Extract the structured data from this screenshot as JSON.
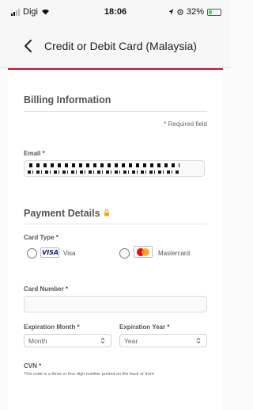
{
  "status_bar": {
    "carrier": "Digi",
    "time": "18:06",
    "battery_text": "32%",
    "battery_level": 0.32
  },
  "header": {
    "title": "Credit or Debit Card (Malaysia)"
  },
  "billing": {
    "title": "Billing Information",
    "required_note": "* Required field",
    "email_label": "Email *"
  },
  "payment": {
    "title": "Payment Details",
    "card_type_label": "Card Type *",
    "options": [
      {
        "logo_text": "VISA",
        "label": "Visa"
      },
      {
        "logo_text": "",
        "label": "Mastercard"
      }
    ],
    "card_number_label": "Card Number *",
    "exp_month_label": "Expiration Month *",
    "exp_month_value": "Month",
    "exp_year_label": "Expiration Year *",
    "exp_year_value": "Year",
    "cvn_label": "CVN *",
    "cvn_help": "This code is a three or four digit number printed on the back or front"
  },
  "colors": {
    "accent": "#c8102e",
    "lock": "#f5a623",
    "mc_red": "#eb001b",
    "mc_orange": "#f79e1b",
    "visa_blue": "#1a1f71"
  },
  "icons": {
    "back": "chevron-left-icon",
    "lock": "lock-icon",
    "signal": "cellular-signal-icon",
    "wifi": "wifi-icon",
    "location": "location-arrow-icon",
    "alarm": "alarm-icon",
    "battery": "battery-icon"
  }
}
